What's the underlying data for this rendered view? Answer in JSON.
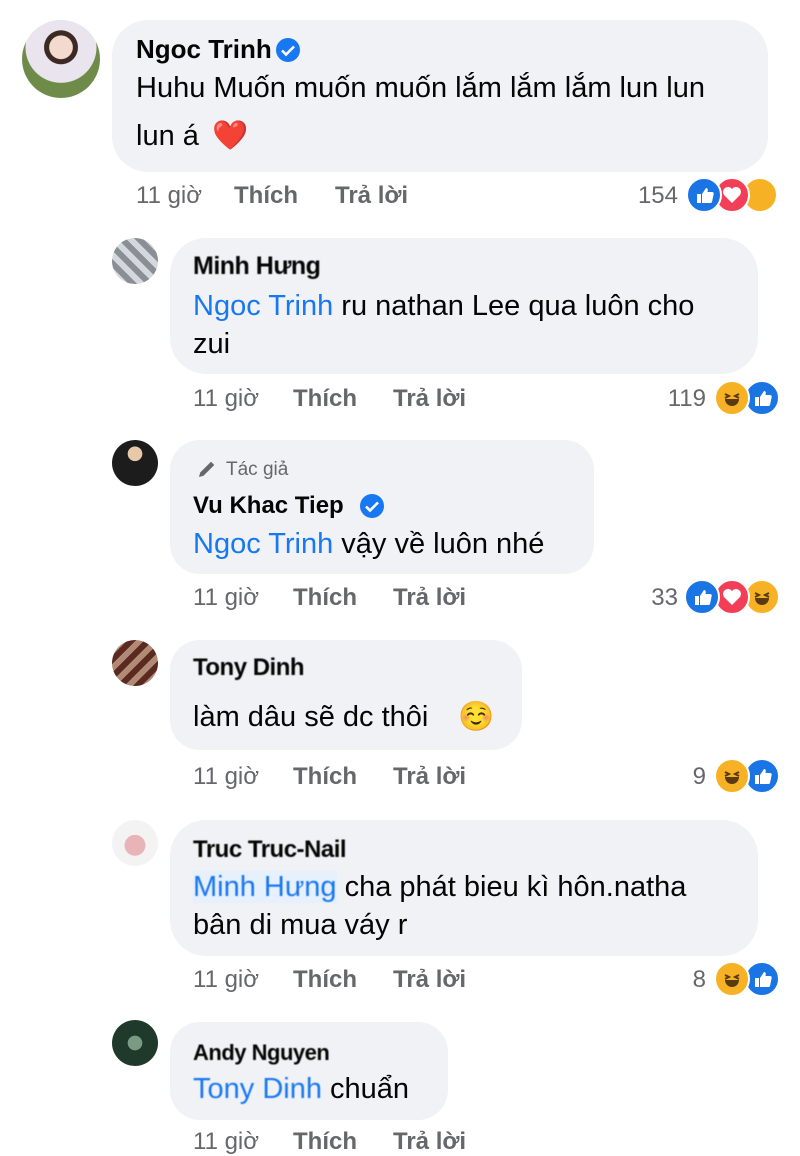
{
  "comments": [
    {
      "author": "Ngoc Trinh",
      "verified": true,
      "lines": [
        "Huhu Muốn muốn muốn lắm lắm lắm lun lun",
        "lun á"
      ],
      "emoji": "❤️",
      "time": "11 giờ",
      "like_label": "Thích",
      "reply_label": "Trả lời",
      "reaction_count": "154",
      "reactions": [
        "like",
        "love",
        "haha"
      ]
    },
    {
      "author": "Minh Hưng",
      "mention": "Ngoc Trinh",
      "lines": [
        " ru nathan Lee qua luôn cho",
        "zui"
      ],
      "time": "11 giờ",
      "like_label": "Thích",
      "reply_label": "Trả lời",
      "reaction_count": "119",
      "reactions": [
        "haha",
        "like"
      ]
    },
    {
      "author_badge": "Tác giả",
      "author": "Vu Khac Tiep",
      "verified": true,
      "mention": "Ngoc Trinh",
      "lines": [
        " vậy về luôn nhé"
      ],
      "time": "11 giờ",
      "like_label": "Thích",
      "reply_label": "Trả lời",
      "reaction_count": "33",
      "reactions": [
        "like",
        "love",
        "haha"
      ]
    },
    {
      "author": "Tony Dinh",
      "lines": [
        "làm dâu sẽ dc thôi"
      ],
      "emoji": "☺️",
      "time": "11 giờ",
      "like_label": "Thích",
      "reply_label": "Trả lời",
      "reaction_count": "9",
      "reactions": [
        "haha",
        "like"
      ]
    },
    {
      "author": "Truc Truc-Nail",
      "mention": "Minh Hưng",
      "lines": [
        " cha phát bieu kì hôn.natha",
        "bân di mua váy r"
      ],
      "time": "11 giờ",
      "like_label": "Thích",
      "reply_label": "Trả lời",
      "reaction_count": "8",
      "reactions": [
        "haha",
        "like"
      ]
    },
    {
      "author": "Andy Nguyen",
      "mention": "Tony Dinh",
      "lines": [
        " chuẩn"
      ],
      "time": "11 giờ",
      "like_label": "Thích",
      "reply_label": "Trả lời"
    }
  ],
  "colors": {
    "like": "#1b74e4",
    "love": "#f33e58",
    "haha": "#f7b125",
    "mention": "#1877f2",
    "bubble": "#f0f2f5"
  }
}
